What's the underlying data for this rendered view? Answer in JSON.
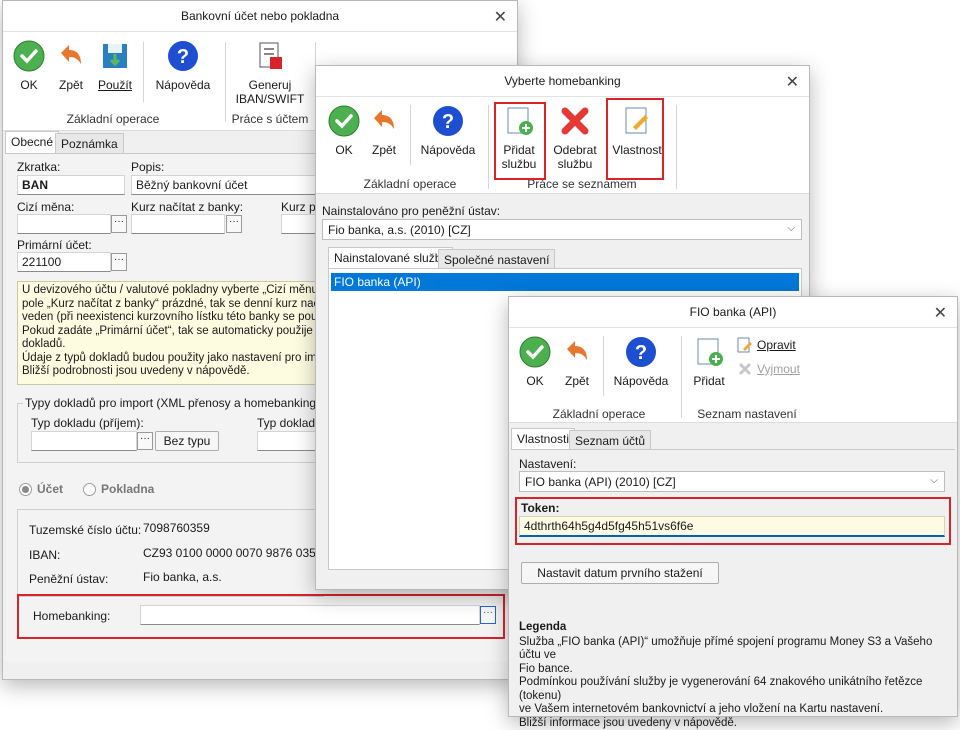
{
  "w1": {
    "title": "Bankovní účet nebo pokladna",
    "ribbon": {
      "ok": "OK",
      "zpet": "Zpět",
      "pouzit": "Použít",
      "napoveda": "Nápověda",
      "generuj": "Generuj IBAN/SWIFT",
      "group1": "Základní operace",
      "group2": "Práce s účtem"
    },
    "tabs": [
      "Obecné",
      "Poznámka"
    ],
    "zkratka_label": "Zkratka:",
    "zkratka_value": "BAN",
    "popis_label": "Popis:",
    "popis_value": "Běžný bankovní účet",
    "cizi_mena_label": "Cizí měna:",
    "kurz_label": "Kurz načítat z banky:",
    "kurz_po_label": "Kurz po",
    "primarni_label": "Primární účet:",
    "primarni_value": "221100",
    "info_lines": [
      "U devizového účtu / valutové pokladny vyberte „Cizí měnu“ a",
      "pole „Kurz načítat z banky“ prázdné, tak se denní kurz načte z",
      "veden (při neexistenci kurzovního lístku této banky se použije",
      "Pokud zadáte „Primární účet“, tak se automaticky použije pro",
      "dokladů.",
      "Údaje z typů dokladů budou použity jako nastavení pro impor",
      "Bližší podrobnosti jsou uvedeny v nápovědě."
    ],
    "typy_legend": "Typy dokladů pro import (XML přenosy a homebanking)",
    "typ_prijem_label": "Typ dokladu (příjem):",
    "typ_dokladu_label": "Typ doklad",
    "bez_typu": "Bez typu",
    "radio_ucet": "Účet",
    "radio_pokladna": "Pokladna",
    "tuzemske_label": "Tuzemské číslo účtu:",
    "tuzemske_value": "7098760359",
    "iban_label": "IBAN:",
    "iban_value": "CZ93 0100 0000 0070 9876 0359",
    "penezni_label": "Peněžní ústav:",
    "penezni_value": "Fio banka, a.s.",
    "homebanking_label": "Homebanking:",
    "homebanking_value": ""
  },
  "w2": {
    "title": "Vyberte homebanking",
    "ribbon": {
      "ok": "OK",
      "zpet": "Zpět",
      "napoveda": "Nápověda",
      "pridat": "Přidat službu",
      "odebrat": "Odebrat službu",
      "vlastnost": "Vlastnost",
      "group1": "Základní operace",
      "group2": "Práce se seznamem"
    },
    "ustav_label": "Nainstalováno pro peněžní ústav:",
    "ustav_value": "Fio banka, a.s. (2010) [CZ]",
    "tabs": [
      "Nainstalované služby",
      "Společné nastavení"
    ],
    "list": [
      "FIO banka (API)"
    ]
  },
  "w3": {
    "title": "FIO banka (API)",
    "ribbon": {
      "ok": "OK",
      "zpet": "Zpět",
      "napoveda": "Nápověda",
      "pridat": "Přidat",
      "opravit": "Opravit",
      "vyjmout": "Vyjmout",
      "group1": "Základní operace",
      "group2": "Seznam nastavení"
    },
    "tabs": [
      "Vlastnosti",
      "Seznam účtů"
    ],
    "nastaveni_label": "Nastavení:",
    "nastaveni_value": "FIO banka (API) (2010) [CZ]",
    "token_label": "Token:",
    "token_value": "4dthrth64h5g4d5fg45h51vs6f6e",
    "datum_btn": "Nastavit datum prvního stažení",
    "legenda_title": "Legenda",
    "legenda_lines": [
      "Služba „FIO banka (API)“ umožňuje přímé spojení programu Money S3 a Vašeho účtu ve",
      "Fio bance.",
      "Podmínkou používání služby je vygenerování 64 znakového unikátního řetězce (tokenu)",
      "ve Vašem internetovém bankovnictví a jeho vložení na Kartu nastavení.",
      "Bližší informace jsou uvedeny v nápovědě."
    ]
  },
  "colors": {
    "highlight": "#d8232a",
    "selection": "#0078d7",
    "ok_green": "#4caf50",
    "help_blue": "#1f4fd1",
    "token_bg": "#fdfbe3"
  }
}
